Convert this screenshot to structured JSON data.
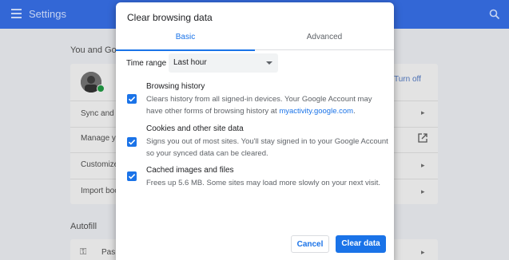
{
  "settings": {
    "title": "Settings",
    "section_you": "You and Goo",
    "turn_off": "Turn off",
    "rows": [
      "Sync and G",
      "Manage yo",
      "Customize",
      "Import boo"
    ],
    "section_autofill": "Autofill",
    "pas": "Pas"
  },
  "dialog": {
    "title": "Clear browsing data",
    "tabs": [
      {
        "label": "Basic",
        "active": true
      },
      {
        "label": "Advanced",
        "active": false
      }
    ],
    "time_range_label": "Time range",
    "time_range_value": "Last hour",
    "options": [
      {
        "title": "Browsing history",
        "desc_pre": "Clears history from all signed-in devices. Your Google Account may have other forms of browsing history at ",
        "desc_link": "myactivity.google.com",
        "desc_post": ".",
        "checked": true
      },
      {
        "title": "Cookies and other site data",
        "desc": "Signs you out of most sites. You'll stay signed in to your Google Account so your synced data can be cleared.",
        "checked": true
      },
      {
        "title": "Cached images and files",
        "desc": "Frees up 5.6 MB. Some sites may load more slowly on your next visit.",
        "checked": true
      }
    ],
    "cancel": "Cancel",
    "clear": "Clear data"
  },
  "icons": [
    "menu-icon",
    "search-icon",
    "avatar",
    "external-link-icon",
    "key-icon",
    "chevron-down-icon",
    "check-icon"
  ],
  "colors": {
    "accent": "#1a73e8",
    "topbar": "#3367d6"
  }
}
